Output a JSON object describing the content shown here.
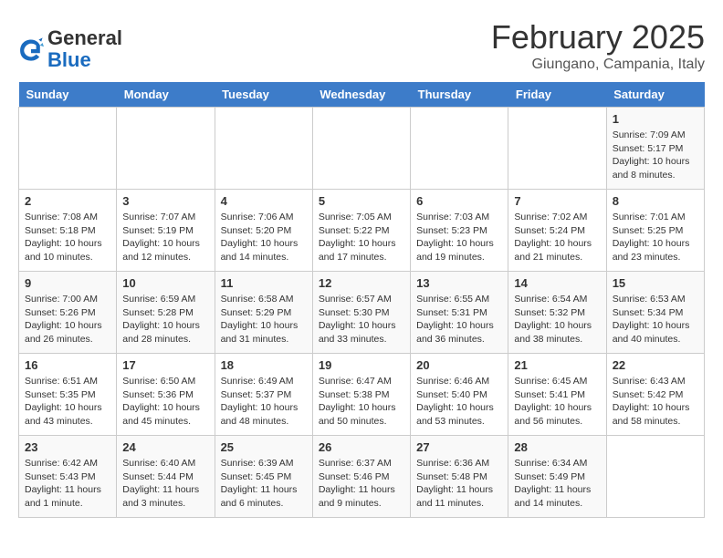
{
  "header": {
    "logo_general": "General",
    "logo_blue": "Blue",
    "title": "February 2025",
    "subtitle": "Giungano, Campania, Italy"
  },
  "days_of_week": [
    "Sunday",
    "Monday",
    "Tuesday",
    "Wednesday",
    "Thursday",
    "Friday",
    "Saturday"
  ],
  "weeks": [
    [
      {
        "day": "",
        "info": ""
      },
      {
        "day": "",
        "info": ""
      },
      {
        "day": "",
        "info": ""
      },
      {
        "day": "",
        "info": ""
      },
      {
        "day": "",
        "info": ""
      },
      {
        "day": "",
        "info": ""
      },
      {
        "day": "1",
        "info": "Sunrise: 7:09 AM\nSunset: 5:17 PM\nDaylight: 10 hours\nand 8 minutes."
      }
    ],
    [
      {
        "day": "2",
        "info": "Sunrise: 7:08 AM\nSunset: 5:18 PM\nDaylight: 10 hours\nand 10 minutes."
      },
      {
        "day": "3",
        "info": "Sunrise: 7:07 AM\nSunset: 5:19 PM\nDaylight: 10 hours\nand 12 minutes."
      },
      {
        "day": "4",
        "info": "Sunrise: 7:06 AM\nSunset: 5:20 PM\nDaylight: 10 hours\nand 14 minutes."
      },
      {
        "day": "5",
        "info": "Sunrise: 7:05 AM\nSunset: 5:22 PM\nDaylight: 10 hours\nand 17 minutes."
      },
      {
        "day": "6",
        "info": "Sunrise: 7:03 AM\nSunset: 5:23 PM\nDaylight: 10 hours\nand 19 minutes."
      },
      {
        "day": "7",
        "info": "Sunrise: 7:02 AM\nSunset: 5:24 PM\nDaylight: 10 hours\nand 21 minutes."
      },
      {
        "day": "8",
        "info": "Sunrise: 7:01 AM\nSunset: 5:25 PM\nDaylight: 10 hours\nand 23 minutes."
      }
    ],
    [
      {
        "day": "9",
        "info": "Sunrise: 7:00 AM\nSunset: 5:26 PM\nDaylight: 10 hours\nand 26 minutes."
      },
      {
        "day": "10",
        "info": "Sunrise: 6:59 AM\nSunset: 5:28 PM\nDaylight: 10 hours\nand 28 minutes."
      },
      {
        "day": "11",
        "info": "Sunrise: 6:58 AM\nSunset: 5:29 PM\nDaylight: 10 hours\nand 31 minutes."
      },
      {
        "day": "12",
        "info": "Sunrise: 6:57 AM\nSunset: 5:30 PM\nDaylight: 10 hours\nand 33 minutes."
      },
      {
        "day": "13",
        "info": "Sunrise: 6:55 AM\nSunset: 5:31 PM\nDaylight: 10 hours\nand 36 minutes."
      },
      {
        "day": "14",
        "info": "Sunrise: 6:54 AM\nSunset: 5:32 PM\nDaylight: 10 hours\nand 38 minutes."
      },
      {
        "day": "15",
        "info": "Sunrise: 6:53 AM\nSunset: 5:34 PM\nDaylight: 10 hours\nand 40 minutes."
      }
    ],
    [
      {
        "day": "16",
        "info": "Sunrise: 6:51 AM\nSunset: 5:35 PM\nDaylight: 10 hours\nand 43 minutes."
      },
      {
        "day": "17",
        "info": "Sunrise: 6:50 AM\nSunset: 5:36 PM\nDaylight: 10 hours\nand 45 minutes."
      },
      {
        "day": "18",
        "info": "Sunrise: 6:49 AM\nSunset: 5:37 PM\nDaylight: 10 hours\nand 48 minutes."
      },
      {
        "day": "19",
        "info": "Sunrise: 6:47 AM\nSunset: 5:38 PM\nDaylight: 10 hours\nand 50 minutes."
      },
      {
        "day": "20",
        "info": "Sunrise: 6:46 AM\nSunset: 5:40 PM\nDaylight: 10 hours\nand 53 minutes."
      },
      {
        "day": "21",
        "info": "Sunrise: 6:45 AM\nSunset: 5:41 PM\nDaylight: 10 hours\nand 56 minutes."
      },
      {
        "day": "22",
        "info": "Sunrise: 6:43 AM\nSunset: 5:42 PM\nDaylight: 10 hours\nand 58 minutes."
      }
    ],
    [
      {
        "day": "23",
        "info": "Sunrise: 6:42 AM\nSunset: 5:43 PM\nDaylight: 11 hours\nand 1 minute."
      },
      {
        "day": "24",
        "info": "Sunrise: 6:40 AM\nSunset: 5:44 PM\nDaylight: 11 hours\nand 3 minutes."
      },
      {
        "day": "25",
        "info": "Sunrise: 6:39 AM\nSunset: 5:45 PM\nDaylight: 11 hours\nand 6 minutes."
      },
      {
        "day": "26",
        "info": "Sunrise: 6:37 AM\nSunset: 5:46 PM\nDaylight: 11 hours\nand 9 minutes."
      },
      {
        "day": "27",
        "info": "Sunrise: 6:36 AM\nSunset: 5:48 PM\nDaylight: 11 hours\nand 11 minutes."
      },
      {
        "day": "28",
        "info": "Sunrise: 6:34 AM\nSunset: 5:49 PM\nDaylight: 11 hours\nand 14 minutes."
      },
      {
        "day": "",
        "info": ""
      }
    ]
  ]
}
